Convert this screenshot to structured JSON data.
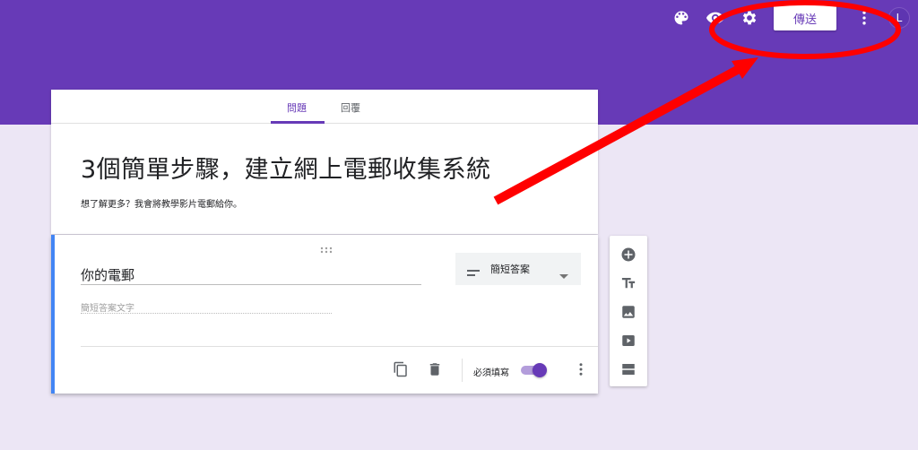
{
  "header": {
    "send_label": "傳送",
    "avatar_letter": "L",
    "icons": [
      "palette-icon",
      "preview-eye-icon",
      "settings-gear-icon",
      "more-vert-icon"
    ]
  },
  "tabs": [
    {
      "label": "問題",
      "active": true
    },
    {
      "label": "回覆",
      "active": false
    }
  ],
  "form": {
    "title": "3個簡單步驟，建立網上電郵收集系統",
    "description": "想了解更多？我會將教學影片電郵給你。"
  },
  "question": {
    "title": "你的電郵",
    "type_label": "簡短答案",
    "answer_placeholder": "簡短答案文字",
    "required_label": "必須填寫",
    "required": true
  },
  "side_toolbar": [
    "add-question-icon",
    "add-title-icon",
    "add-image-icon",
    "add-video-icon",
    "add-section-icon"
  ],
  "colors": {
    "banner": "#673ab7",
    "background": "#ece6f5",
    "accent": "#673ab7",
    "question_border": "#4285f4",
    "annotation": "#ff0000"
  }
}
